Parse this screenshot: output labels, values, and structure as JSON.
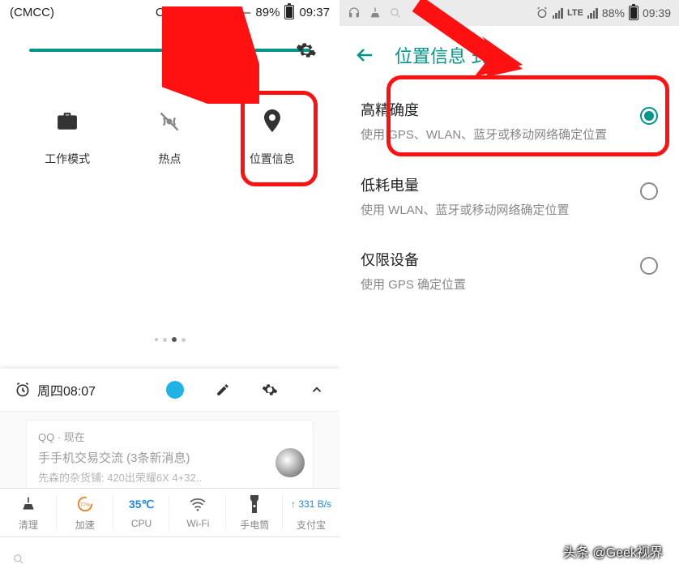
{
  "left": {
    "status": {
      "carrier_left": "(CMCC)",
      "carrier_right": "CHN-UNICOM —",
      "battery": "89%",
      "time": "09:37"
    },
    "tiles": {
      "work": "工作模式",
      "hotspot": "热点",
      "location": "位置信息"
    },
    "notif_head": {
      "alarm": "周四08:07"
    },
    "qq": {
      "src": "QQ · 现在",
      "title": "手手机交易交流 (3条新消息)",
      "body": "先森的杂货铺: 420出荣耀6X   4+32.."
    },
    "tools": {
      "clean": "清理",
      "boost": "加速",
      "boost_pct": "77%",
      "cpu": "CPU",
      "cpu_temp": "35℃",
      "wifi": "Wi-Fi",
      "torch": "手电筒",
      "alipay": "支付宝",
      "net": "↑ 331 B/s"
    }
  },
  "right": {
    "status": {
      "battery": "88%",
      "time": "09:39",
      "lte": "LTE"
    },
    "title": "位置信息     式",
    "options": {
      "high": {
        "title": "高精确度",
        "desc": "使用 GPS、WLAN、蓝牙或移动网络确定位置"
      },
      "low": {
        "title": "低耗电量",
        "desc": "使用 WLAN、蓝牙或移动网络确定位置"
      },
      "dev": {
        "title": "仅限设备",
        "desc": "使用 GPS 确定位置"
      }
    }
  },
  "watermark": "头条 @Geek视界"
}
